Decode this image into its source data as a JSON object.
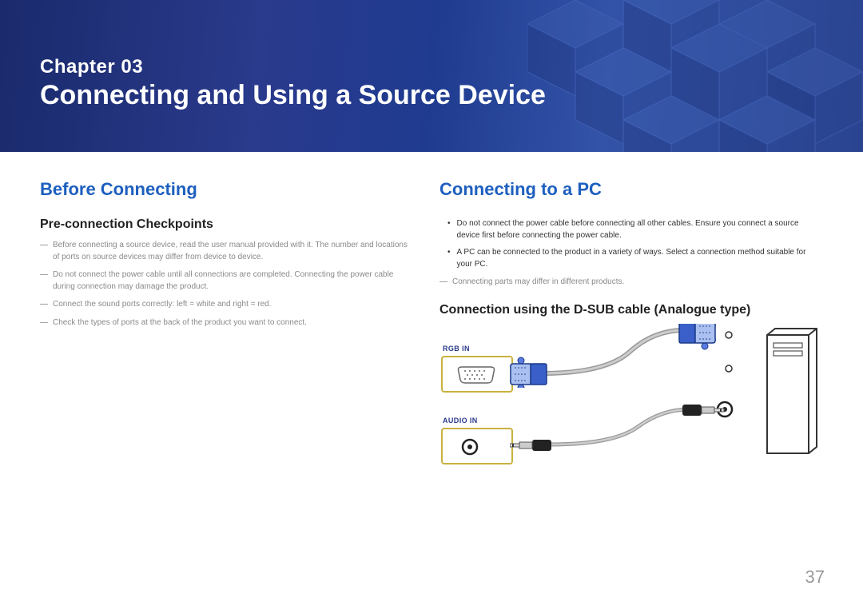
{
  "header": {
    "chapter_label": "Chapter  03",
    "chapter_title": "Connecting and Using a Source Device"
  },
  "left": {
    "heading": "Before Connecting",
    "subheading": "Pre-connection Checkpoints",
    "items": [
      "Before connecting a source device, read the user manual provided with it. The number and locations of ports on source devices may differ from device to device.",
      "Do not connect the power cable until all connections are completed. Connecting the power cable during connection may damage the product.",
      "Connect the sound ports correctly: left = white and right = red.",
      "Check the types of ports at the back of the product you want to connect."
    ]
  },
  "right": {
    "heading": "Connecting to a PC",
    "bullets": [
      "Do not connect the power cable before connecting all other cables. Ensure you connect a source device first before connecting the power cable.",
      "A PC can be connected to the product in a variety of ways. Select a connection method suitable for your PC."
    ],
    "note": "Connecting parts may differ in different products.",
    "subheading": "Connection using the D-SUB cable (Analogue type)",
    "labels": {
      "rgb": "RGB IN",
      "audio": "AUDIO IN"
    }
  },
  "page_number": "37"
}
